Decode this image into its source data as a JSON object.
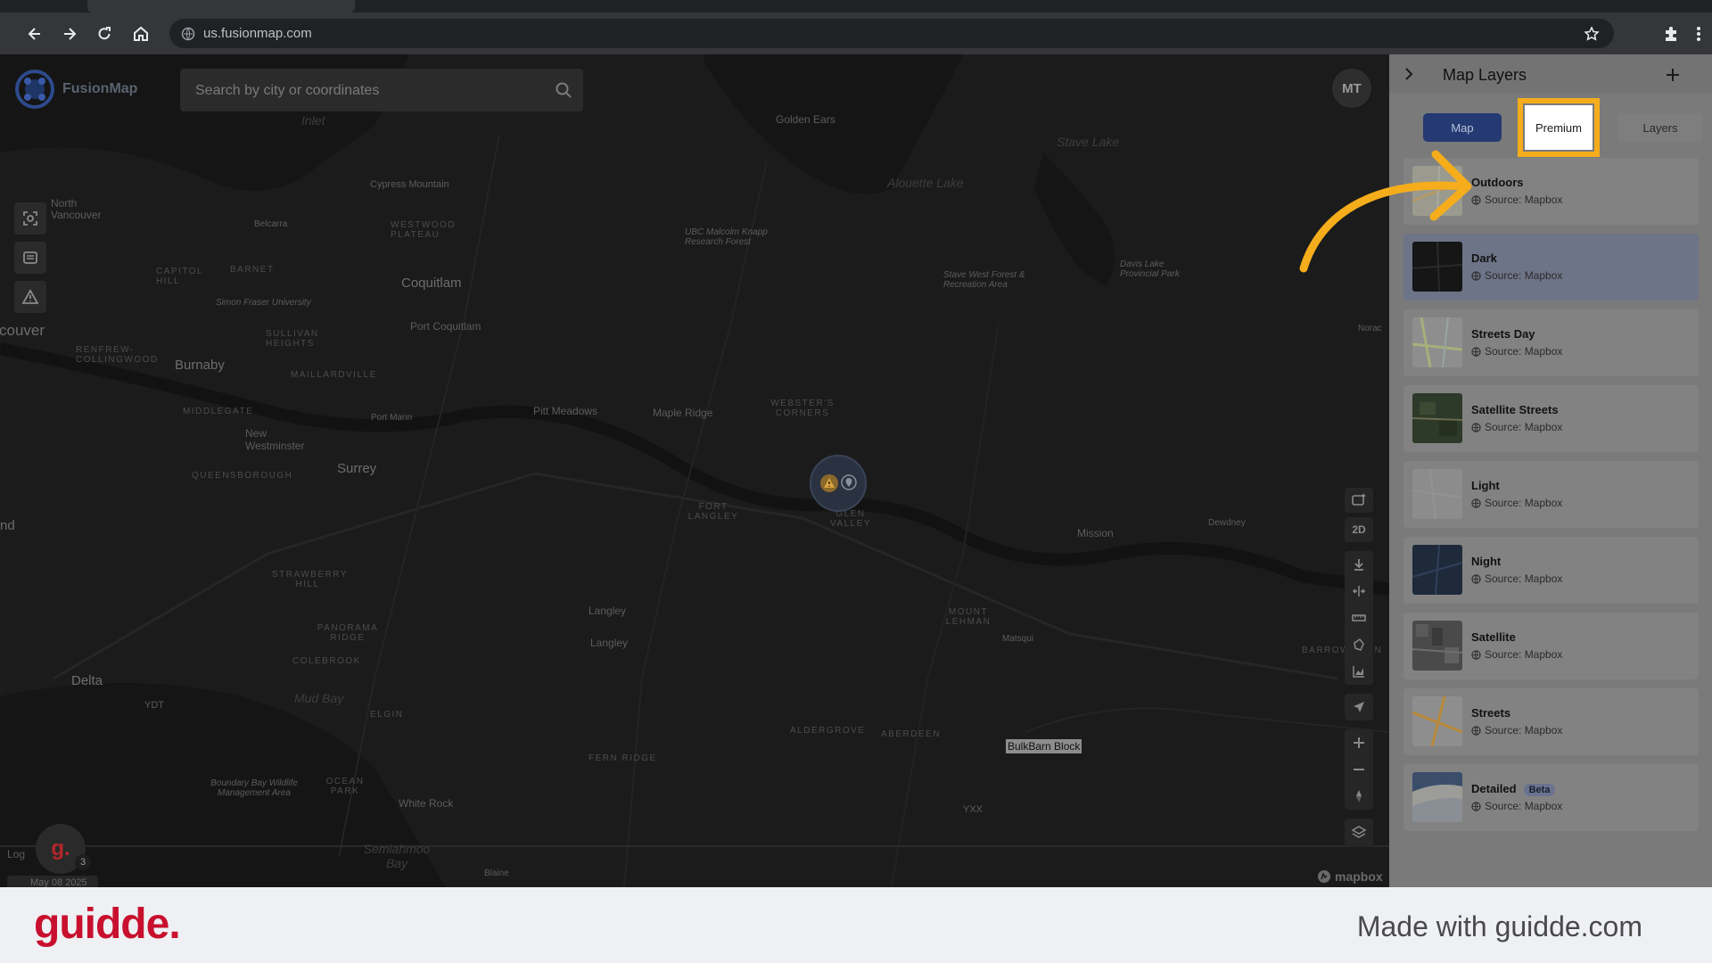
{
  "browser": {
    "url": "us.fusionmap.com"
  },
  "app": {
    "brand": "FusionMap",
    "search_placeholder": "Search by city or coordinates",
    "avatar_initials": "MT",
    "map_labels": {
      "golden_ears": "Golden Ears",
      "stave_lake": "Stave Lake",
      "alouette_lake": "Alouette Lake",
      "cypress_mountain": "Cypress Mountain",
      "inlet": "Inlet",
      "north_vancouver": "North Vancouver",
      "belcarra": "Belcarra",
      "westwood_plateau": "WESTWOOD PLATEAU",
      "ubc_forest": "UBC Malcolm Knapp Research Forest",
      "davis_lake": "Davis Lake Provincial Park",
      "stave_west": "Stave West Forest & Recreation Area",
      "capitol_hill": "CAPITOL HILL",
      "barnet": "BARNET",
      "coquitlam": "Coquitlam",
      "sfu": "Simon Fraser University",
      "vancouver": "Vancouver",
      "renfrew": "RENFREW-COLLINGWOOD",
      "burnaby": "Burnaby",
      "sullivan": "SULLIVAN HEIGHTS",
      "port_coquitlam": "Port Coquitlam",
      "maillardville": "MAILLARDVILLE",
      "middlegate": "MIDDLEGATE",
      "new_westminster": "New Westminster",
      "port_mann": "Port Mann",
      "pitt_meadows": "Pitt Meadows",
      "maple_ridge": "Maple Ridge",
      "websters": "WEBSTER'S CORNERS",
      "queensborough": "QUEENSBOROUGH",
      "surrey": "Surrey",
      "fort_langley": "FORT LANGLEY",
      "glen_valley": "GLEN VALLEY",
      "mission": "Mission",
      "dewdney": "Dewdney",
      "nd": "nd",
      "norac": "Norac",
      "strawberry": "STRAWBERRY HILL",
      "langley1": "Langley",
      "langley2": "Langley",
      "mount_lehman": "MOUNT LEHMAN",
      "matsqui": "Matsqui",
      "panorama": "PANORAMA RIDGE",
      "colebrook": "COLEBROOK",
      "delta": "Delta",
      "ydt": "YDT",
      "mud_bay": "Mud Bay",
      "elgin": "ELGIN",
      "aldergrove": "ALDERGROVE",
      "aberdeen": "ABERDEEN",
      "fern_ridge": "FERN RIDGE",
      "barrowtown": "BARROWTOWN",
      "boundary_bay": "Boundary Bay Wildlife Management Area",
      "ocean_park": "OCEAN PARK",
      "white_rock": "White Rock",
      "yxx": "YXX",
      "semiahmoo_bay": "Semiahmoo Bay",
      "blaine": "Blaine"
    },
    "block_label": "BulkBarn Block",
    "logo_alt": "Log",
    "date_chip": "May 08 2025",
    "badge_count": "3",
    "guidde_avatar_letter": "g.",
    "mapbox": "mapbox",
    "tool_2d": "2D"
  },
  "panel": {
    "title": "Map Layers",
    "tabs": {
      "map": "Map",
      "premium": "Premium",
      "layers": "Layers"
    },
    "layers": [
      {
        "name": "Outdoors",
        "source": "Source: Mapbox"
      },
      {
        "name": "Dark",
        "source": "Source: Mapbox"
      },
      {
        "name": "Streets Day",
        "source": "Source: Mapbox"
      },
      {
        "name": "Satellite Streets",
        "source": "Source: Mapbox"
      },
      {
        "name": "Light",
        "source": "Source: Mapbox"
      },
      {
        "name": "Night",
        "source": "Source: Mapbox"
      },
      {
        "name": "Satellite",
        "source": "Source: Mapbox"
      },
      {
        "name": "Streets",
        "source": "Source: Mapbox"
      },
      {
        "name": "Detailed",
        "source": "Source: Mapbox",
        "badge": "Beta"
      }
    ],
    "selected_layer": "Dark"
  },
  "footer": {
    "brand": "guidde.",
    "made_with": "Made with guidde.com"
  },
  "colors": {
    "highlight": "#f5ad1c",
    "guidde_red": "#c8102e",
    "map_tab_blue": "#253a73"
  }
}
